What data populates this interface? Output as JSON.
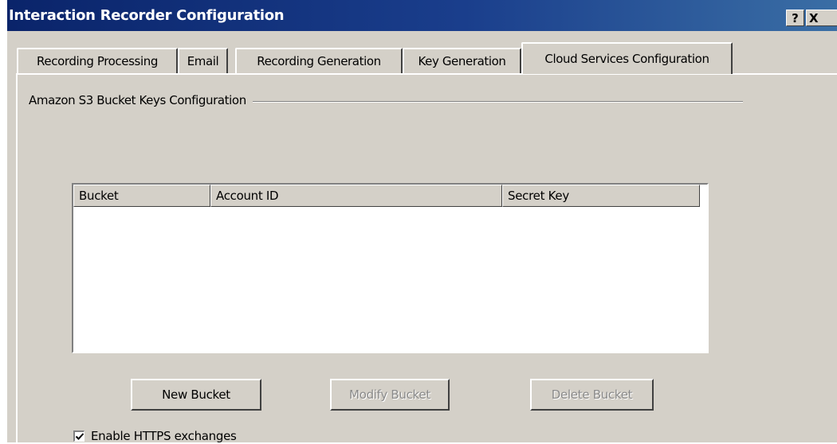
{
  "window": {
    "title": "Interaction Recorder Configuration",
    "help_label": "?",
    "close_label": "X"
  },
  "tabs": [
    {
      "label": "Recording Processing",
      "active": false
    },
    {
      "label": "Email",
      "active": false
    },
    {
      "label": "Recording Generation",
      "active": false
    },
    {
      "label": "Key Generation",
      "active": false
    },
    {
      "label": "Cloud Services Configuration",
      "active": true
    }
  ],
  "group": {
    "title": "Amazon S3 Bucket Keys Configuration"
  },
  "table": {
    "columns": [
      "Bucket",
      "Account ID",
      "Secret Key"
    ],
    "rows": []
  },
  "buttons": {
    "new_bucket": "New Bucket",
    "modify_bucket": "Modify Bucket",
    "delete_bucket": "Delete Bucket"
  },
  "options": {
    "enable_https_label": "Enable HTTPS exchanges",
    "enable_https_checked": true
  },
  "colors": {
    "titlebar": "#0a246a",
    "dialog_face": "#d4d0c8",
    "disabled_text": "#8a8a8a"
  }
}
